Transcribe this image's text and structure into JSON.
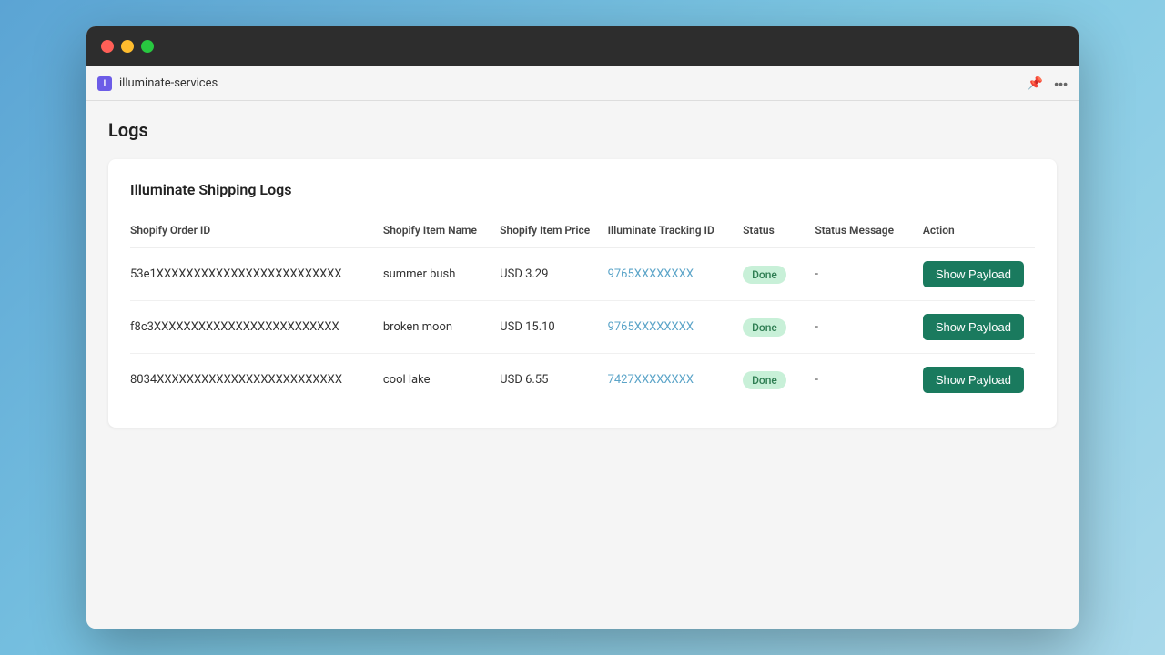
{
  "window": {
    "tab": {
      "icon_text": "I",
      "title": "illuminate-services",
      "pin_icon": "📌",
      "more_icon": "···"
    },
    "page_title": "Logs",
    "card": {
      "title": "Illuminate Shipping Logs",
      "columns": [
        "Shopify Order ID",
        "Shopify Item Name",
        "Shopify Item Price",
        "Illuminate Tracking ID",
        "Status",
        "Status Message",
        "Action"
      ],
      "rows": [
        {
          "order_id": "53e1XXXXXXXXXXXXXXXXXXXXXXXXX",
          "item_name": "summer bush",
          "item_price": "USD 3.29",
          "tracking_id": "9765XXXXXXXX",
          "status": "Done",
          "status_message": "-",
          "action": "Show Payload"
        },
        {
          "order_id": "f8c3XXXXXXXXXXXXXXXXXXXXXXXXX",
          "item_name": "broken moon",
          "item_price": "USD 15.10",
          "tracking_id": "9765XXXXXXXX",
          "status": "Done",
          "status_message": "-",
          "action": "Show Payload"
        },
        {
          "order_id": "8034XXXXXXXXXXXXXXXXXXXXXXXXX",
          "item_name": "cool lake",
          "item_price": "USD 6.55",
          "tracking_id": "7427XXXXXXXX",
          "status": "Done",
          "status_message": "-",
          "action": "Show Payload"
        }
      ]
    }
  }
}
